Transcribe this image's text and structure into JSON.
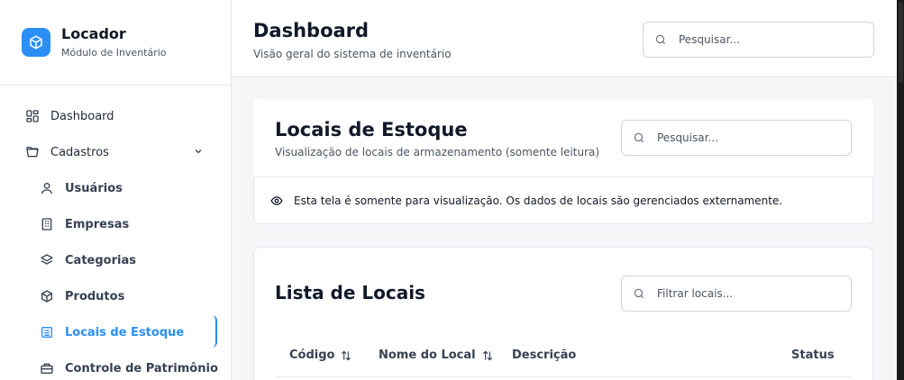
{
  "brand": {
    "title": "Locador",
    "subtitle": "Módulo de Inventário",
    "logo_icon": "package-icon",
    "accent": "#2b8ff5"
  },
  "sidebar": {
    "items": [
      {
        "label": "Dashboard",
        "icon": "layout-grid-icon"
      },
      {
        "label": "Cadastros",
        "icon": "folder-open-icon",
        "expanded": true
      },
      {
        "label": "Usuários",
        "icon": "user-icon"
      },
      {
        "label": "Empresas",
        "icon": "building-icon"
      },
      {
        "label": "Categorias",
        "icon": "layers-icon"
      },
      {
        "label": "Produtos",
        "icon": "package-icon"
      },
      {
        "label": "Locais de Estoque",
        "icon": "warehouse-icon",
        "active": true
      },
      {
        "label": "Controle de Patrimônio",
        "icon": "briefcase-icon"
      }
    ]
  },
  "header": {
    "title": "Dashboard",
    "subtitle": "Visão geral do sistema de inventário",
    "search_placeholder": "Pesquisar..."
  },
  "page": {
    "title": "Locais de Estoque",
    "subtitle": "Visualização de locais de armazenamento (somente leitura)",
    "search_placeholder": "Pesquisar...",
    "notice": "Esta tela é somente para visualização. Os dados de locais são gerenciados externamente."
  },
  "list": {
    "title": "Lista de Locais",
    "filter_placeholder": "Filtrar locais...",
    "columns": [
      {
        "label": "Código",
        "sortable": true
      },
      {
        "label": "Nome do Local",
        "sortable": true
      },
      {
        "label": "Descrição",
        "sortable": false
      },
      {
        "label": "Status",
        "sortable": false
      }
    ]
  }
}
